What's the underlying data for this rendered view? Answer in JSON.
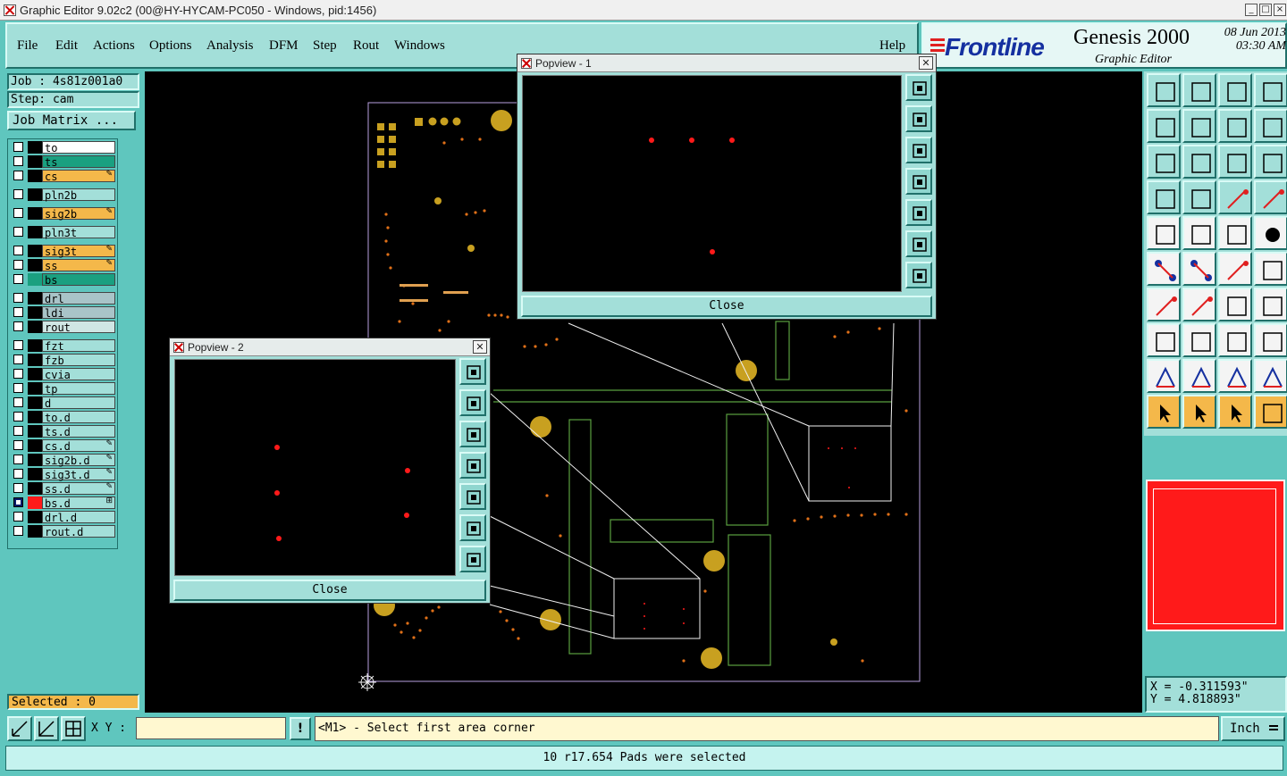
{
  "window": {
    "title": "Graphic Editor 9.02c2 (00@HY-HYCAM-PC050 - Windows, pid:1456)"
  },
  "menu": {
    "items": [
      "File",
      "Edit",
      "Actions",
      "Options",
      "Analysis",
      "DFM",
      "Step",
      "Rout",
      "Windows"
    ],
    "help": "Help"
  },
  "brand": {
    "logo": "Frontline",
    "product": "Genesis 2000",
    "subtitle": "Graphic Editor",
    "date": "08 Jun 2013",
    "time": "03:30 AM"
  },
  "job": {
    "job_label": "Job : 4s81z001a0",
    "step_label": "Step: cam",
    "matrix_button": "Job Matrix ..."
  },
  "layers": [
    {
      "name": "to",
      "color": "#ffffff",
      "row_bg": "#ffffff",
      "flag": ""
    },
    {
      "name": "ts",
      "color": "#1aa080",
      "row_bg": "#1aa080",
      "flag": ""
    },
    {
      "name": "cs",
      "color": "#f4b84a",
      "row_bg": "#f4b84a",
      "flag": "✎"
    },
    {
      "name": "pln2b",
      "color": "#a3dfd9",
      "row_bg": "#a3dfd9",
      "flag": ""
    },
    {
      "name": "sig2b",
      "color": "#f4b84a",
      "row_bg": "#f4b84a",
      "flag": "✎"
    },
    {
      "name": "pln3t",
      "color": "#a3dfd9",
      "row_bg": "#a3dfd9",
      "flag": ""
    },
    {
      "name": "sig3t",
      "color": "#f4b84a",
      "row_bg": "#f4b84a",
      "flag": "✎"
    },
    {
      "name": "ss",
      "color": "#f4b84a",
      "row_bg": "#f4b84a",
      "flag": "✎"
    },
    {
      "name": "bs",
      "color": "#1aa080",
      "row_bg": "#1aa080",
      "flag": ""
    },
    {
      "name": "drl",
      "color": "#a9c4c8",
      "row_bg": "#a9c4c8",
      "flag": ""
    },
    {
      "name": "ldi",
      "color": "#a9c4c8",
      "row_bg": "#a9c4c8",
      "flag": ""
    },
    {
      "name": "rout",
      "color": "#d0e6e4",
      "row_bg": "#d0e6e4",
      "flag": ""
    },
    {
      "name": "fzt",
      "color": "#a3dfd9",
      "row_bg": "#a3dfd9",
      "flag": ""
    },
    {
      "name": "fzb",
      "color": "#a3dfd9",
      "row_bg": "#a3dfd9",
      "flag": ""
    },
    {
      "name": "cvia",
      "color": "#a3dfd9",
      "row_bg": "#a3dfd9",
      "flag": ""
    },
    {
      "name": "tp",
      "color": "#a3dfd9",
      "row_bg": "#a3dfd9",
      "flag": ""
    },
    {
      "name": "d",
      "color": "#a3dfd9",
      "row_bg": "#a3dfd9",
      "flag": ""
    },
    {
      "name": "to.d",
      "color": "#a3dfd9",
      "row_bg": "#a3dfd9",
      "flag": ""
    },
    {
      "name": "ts.d",
      "color": "#a3dfd9",
      "row_bg": "#a3dfd9",
      "flag": ""
    },
    {
      "name": "cs.d",
      "color": "#a3dfd9",
      "row_bg": "#a3dfd9",
      "flag": "✎"
    },
    {
      "name": "sig2b.d",
      "color": "#a3dfd9",
      "row_bg": "#a3dfd9",
      "flag": "✎"
    },
    {
      "name": "sig3t.d",
      "color": "#a3dfd9",
      "row_bg": "#a3dfd9",
      "flag": "✎"
    },
    {
      "name": "ss.d",
      "color": "#a3dfd9",
      "row_bg": "#a3dfd9",
      "flag": "✎"
    },
    {
      "name": "bs.d",
      "color": "#ff1a1a",
      "row_bg": "#a3dfd9",
      "flag": "⊞",
      "active": true
    },
    {
      "name": "drl.d",
      "color": "#a3dfd9",
      "row_bg": "#a3dfd9",
      "flag": ""
    },
    {
      "name": "rout.d",
      "color": "#a3dfd9",
      "row_bg": "#a3dfd9",
      "flag": ""
    }
  ],
  "selection": {
    "label": "Selected : 0"
  },
  "popview1": {
    "title": "Popview - 1",
    "close_label": "Close"
  },
  "popview2": {
    "title": "Popview - 2",
    "close_label": "Close"
  },
  "coords": {
    "x": "X = -0.311593\"",
    "y": "Y = 4.818893\""
  },
  "input": {
    "xy_label": "X Y :",
    "xy_value": "",
    "bang": "!",
    "prompt": "<M1> - Select first area corner",
    "units": "Inch"
  },
  "status": {
    "message": "10 r17.654 Pads were selected"
  },
  "colors": {
    "panel": "#5fc6be",
    "panel_light": "#a3dfd9",
    "pad": "#c8a020",
    "highlight": "#ff1a1a",
    "outline": "#5aa040"
  }
}
